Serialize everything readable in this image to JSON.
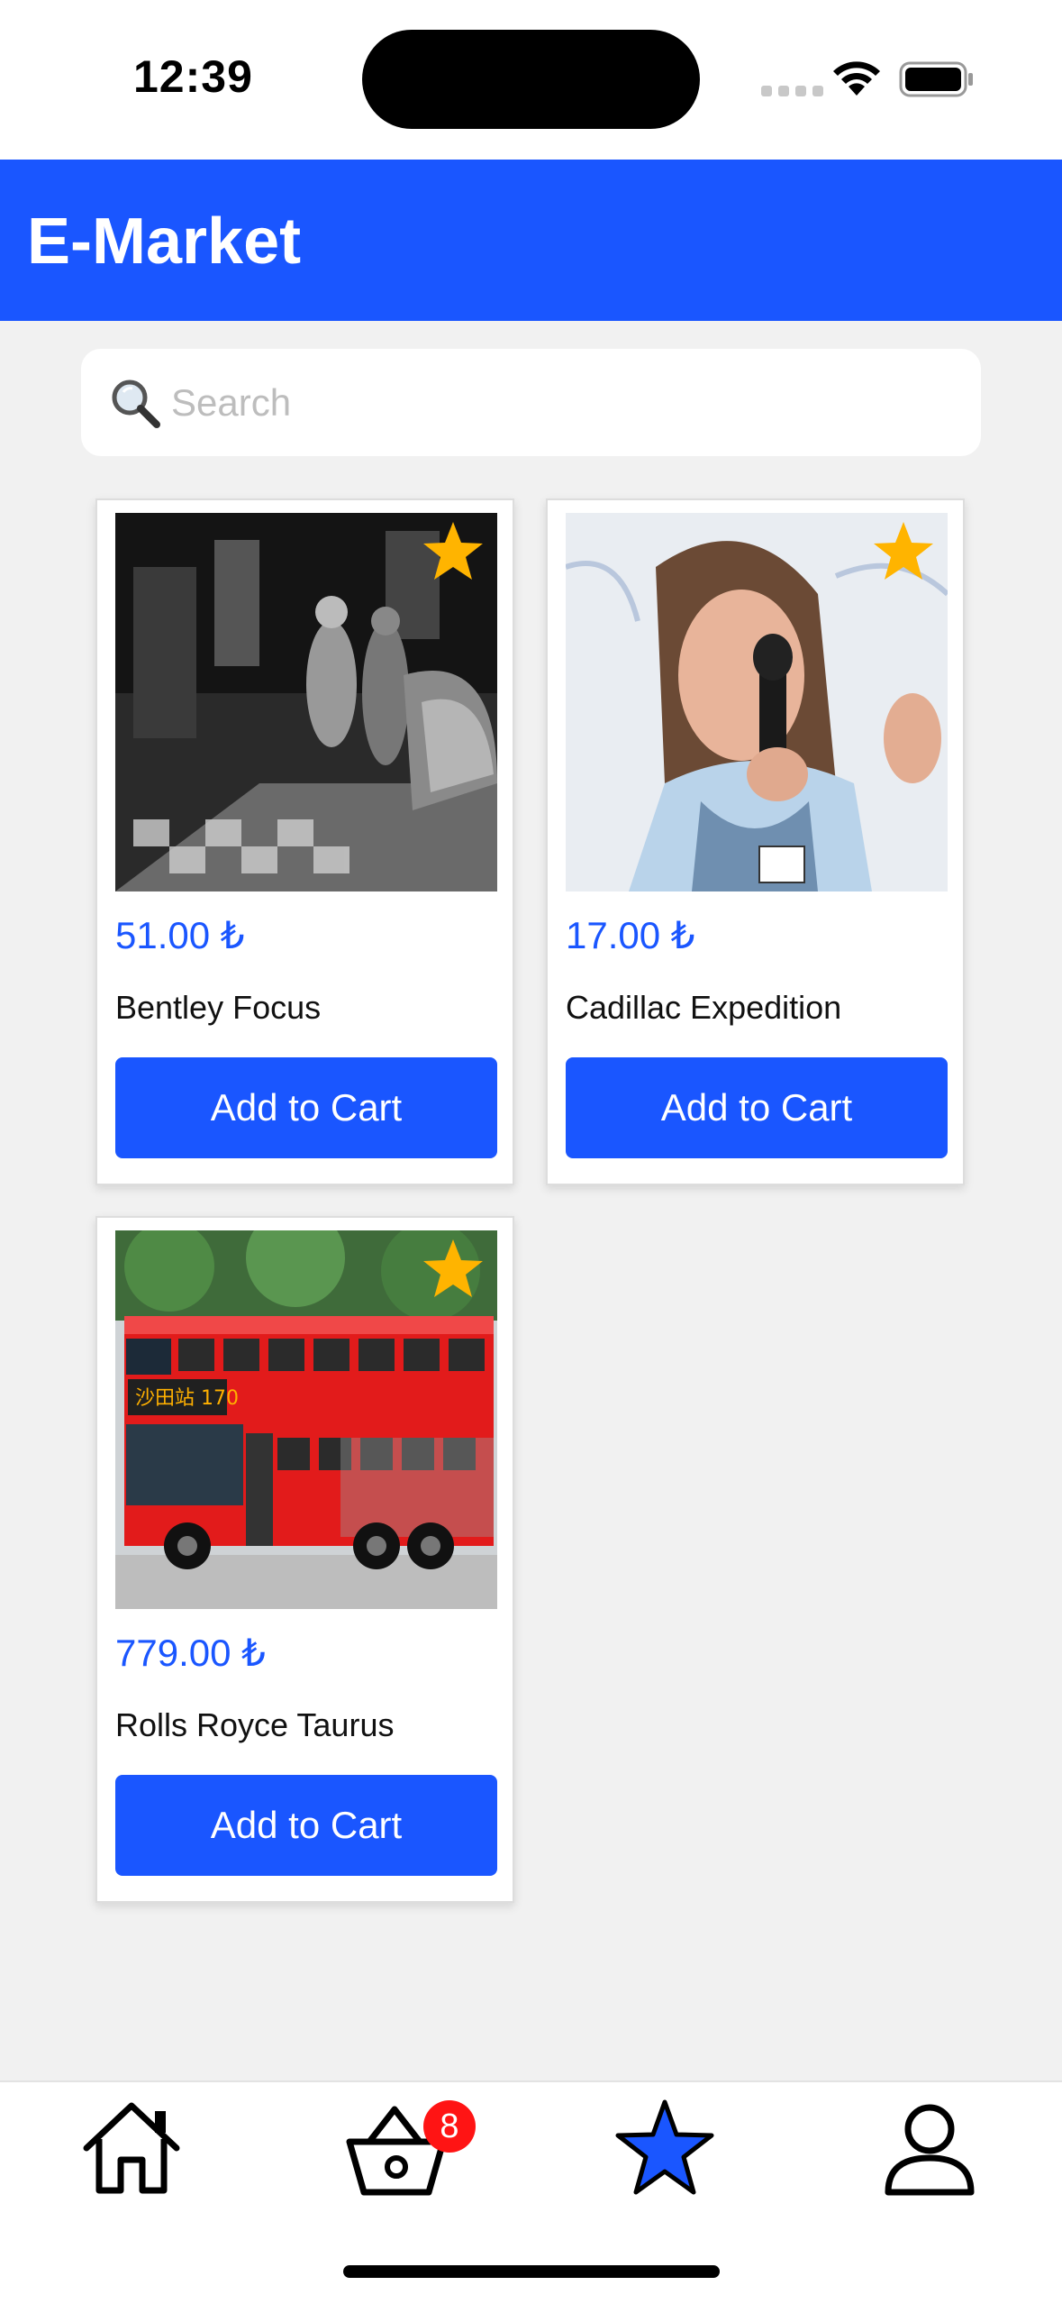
{
  "status_bar": {
    "time": "12:39"
  },
  "header": {
    "title": "E-Market"
  },
  "search": {
    "placeholder": "Search",
    "value": ""
  },
  "products": [
    {
      "price": "51.00 ₺",
      "name": "Bentley Focus",
      "button": "Add to Cart",
      "favorite": true
    },
    {
      "price": "17.00 ₺",
      "name": "Cadillac Expedition",
      "button": "Add to Cart",
      "favorite": true
    },
    {
      "price": "779.00 ₺",
      "name": "Rolls Royce Taurus",
      "button": "Add to Cart",
      "favorite": true
    }
  ],
  "tab_bar": {
    "items": [
      "home-icon",
      "basket-icon",
      "star-icon",
      "profile-icon"
    ],
    "active": "star-icon",
    "cart_badge": "8"
  },
  "colors": {
    "primary": "#1a56ff",
    "favorite": "#ffb400",
    "badge": "#ff1414",
    "background": "#f1f1f1"
  }
}
